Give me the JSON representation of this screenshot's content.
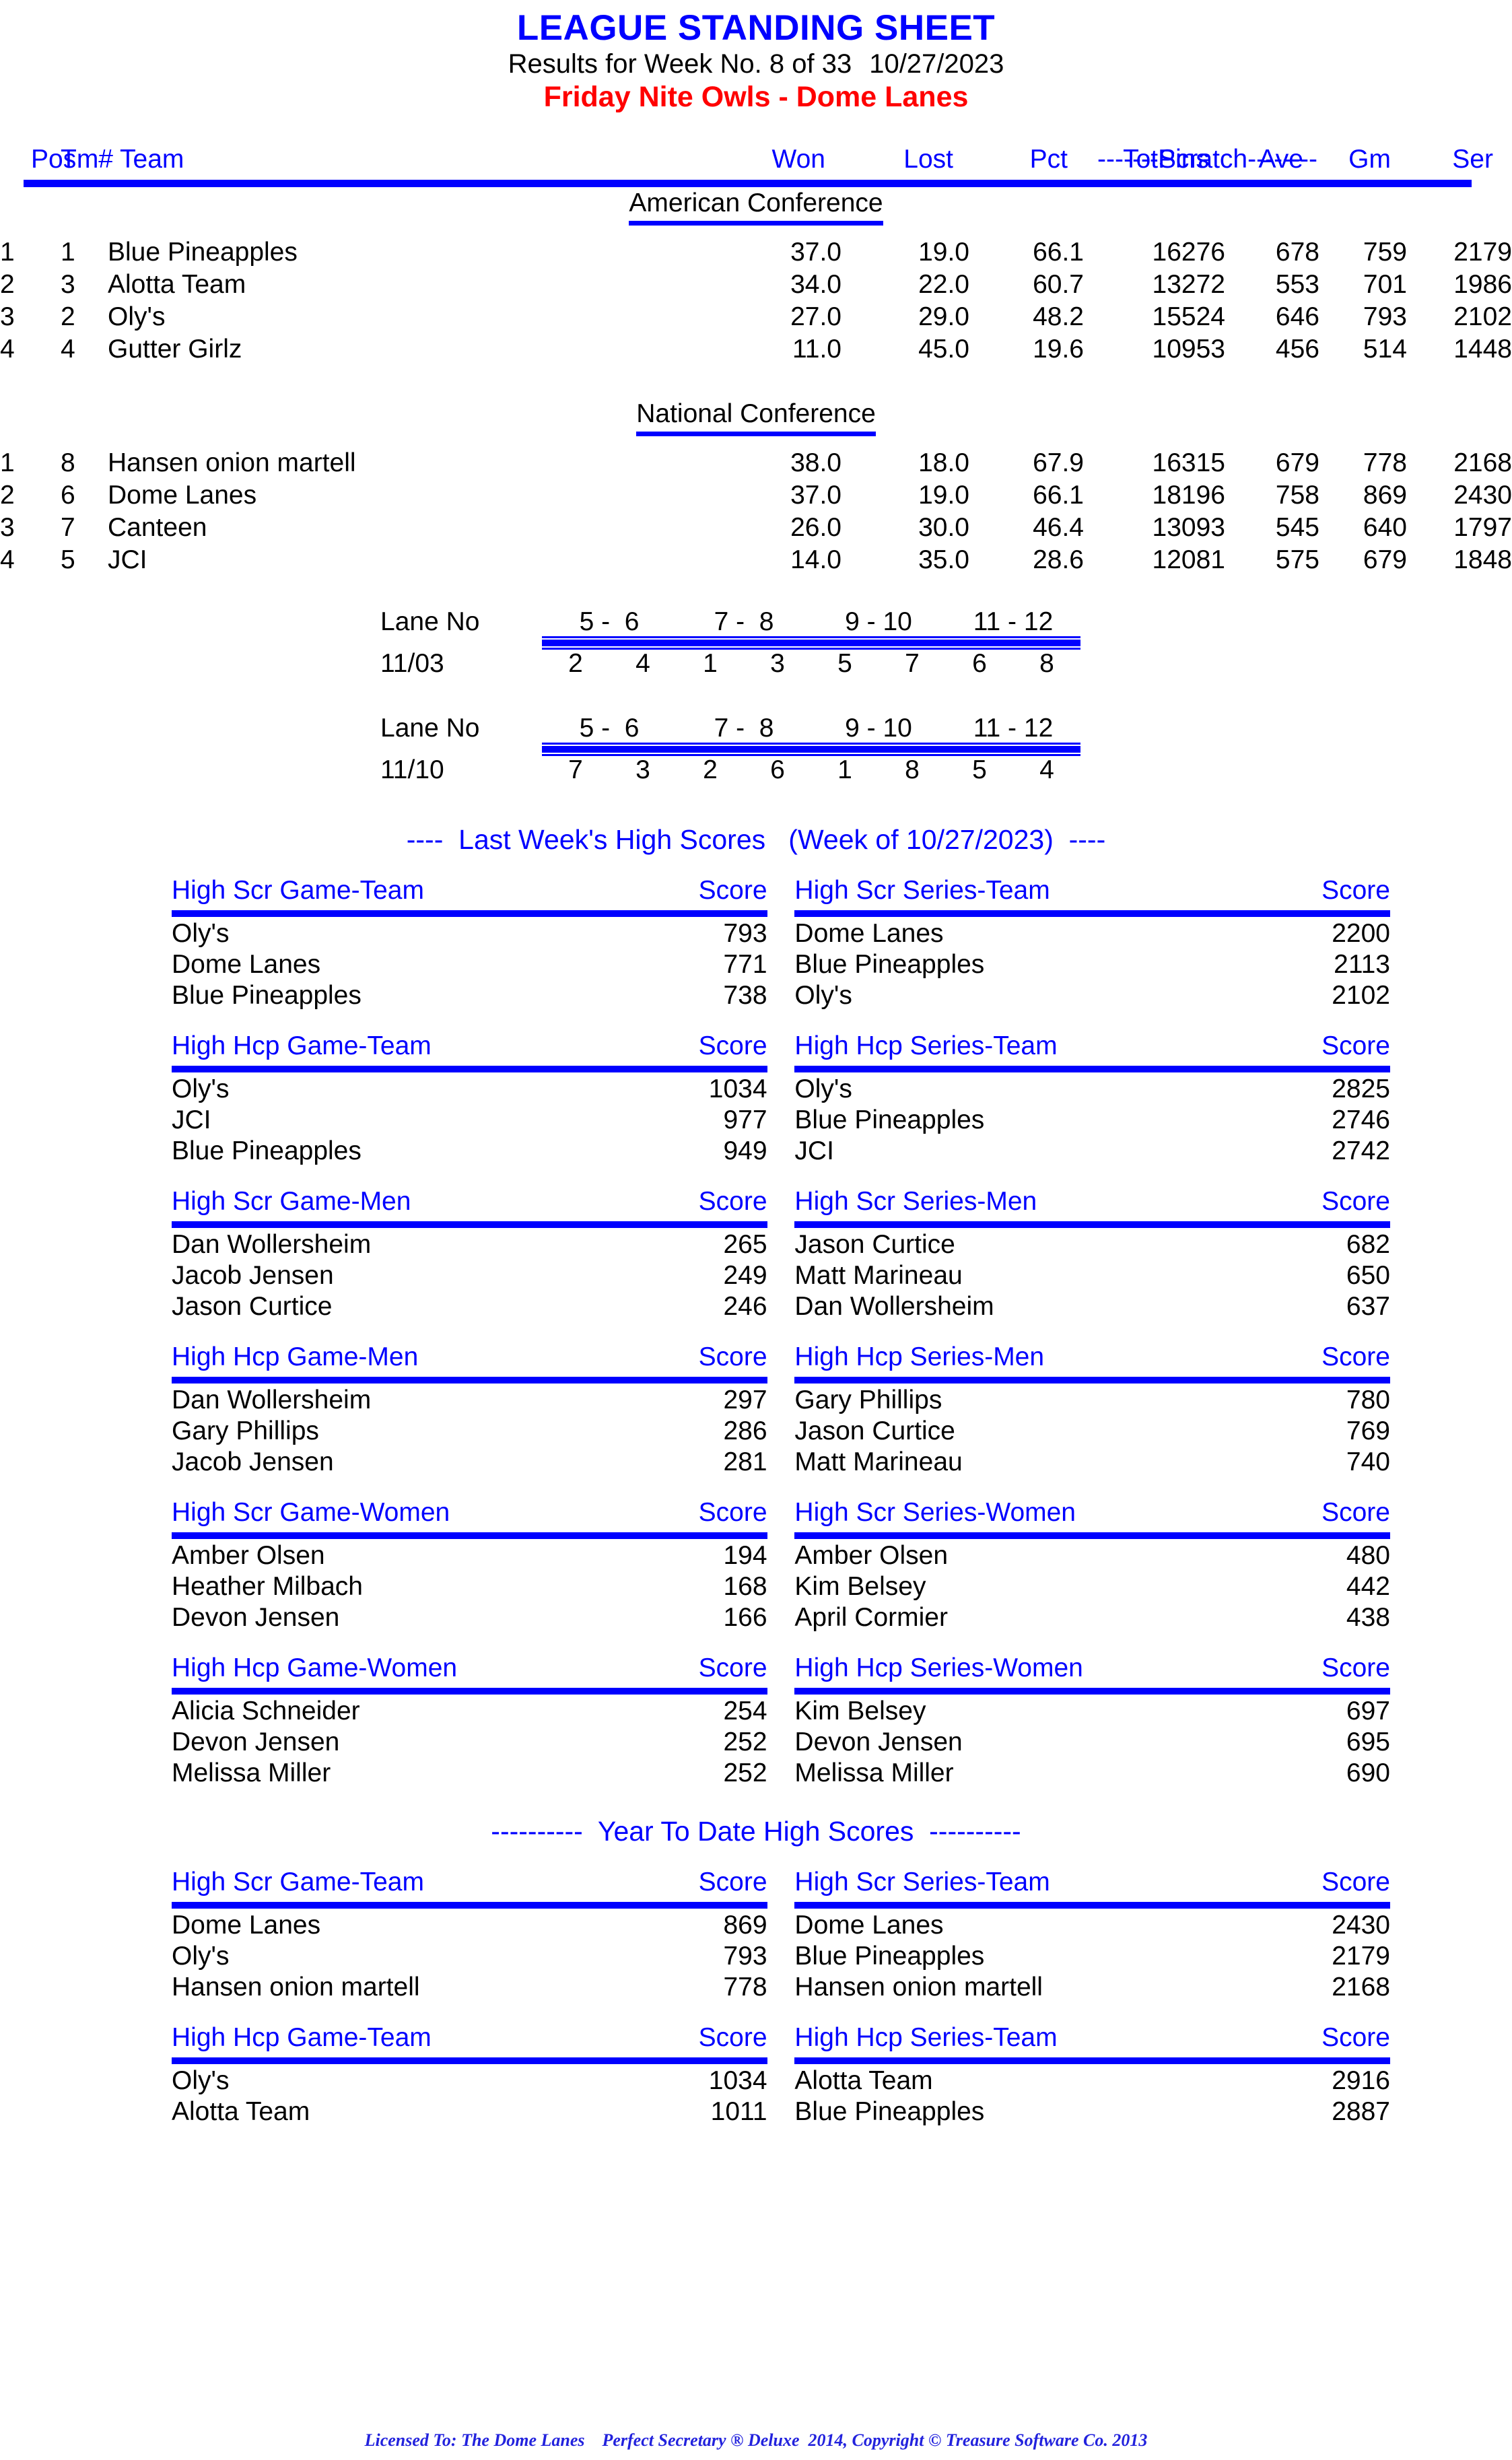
{
  "header": {
    "main_title": "LEAGUE STANDING SHEET",
    "results_line_a": "Results for Week No. 8 of 33",
    "results_line_b": "10/27/2023",
    "league_title": "Friday Nite Owls - Dome Lanes"
  },
  "standings": {
    "scratch_label": "-------Scratch--------",
    "columns": {
      "pos": "Pos",
      "tm": "Tm#",
      "team": "Team",
      "won": "Won",
      "lost": "Lost",
      "pct": "Pct",
      "totpins": "TotPins",
      "ave": "Ave",
      "gm": "Gm",
      "ser": "Ser"
    },
    "conferences": [
      {
        "name": "American Conference",
        "rows": [
          {
            "pos": "1",
            "tm": "1",
            "team": "Blue Pineapples",
            "won": "37.0",
            "lost": "19.0",
            "pct": "66.1",
            "totpins": "16276",
            "ave": "678",
            "gm": "759",
            "ser": "2179"
          },
          {
            "pos": "2",
            "tm": "3",
            "team": "Alotta Team",
            "won": "34.0",
            "lost": "22.0",
            "pct": "60.7",
            "totpins": "13272",
            "ave": "553",
            "gm": "701",
            "ser": "1986"
          },
          {
            "pos": "3",
            "tm": "2",
            "team": "Oly's",
            "won": "27.0",
            "lost": "29.0",
            "pct": "48.2",
            "totpins": "15524",
            "ave": "646",
            "gm": "793",
            "ser": "2102"
          },
          {
            "pos": "4",
            "tm": "4",
            "team": "Gutter Girlz",
            "won": "11.0",
            "lost": "45.0",
            "pct": "19.6",
            "totpins": "10953",
            "ave": "456",
            "gm": "514",
            "ser": "1448"
          }
        ]
      },
      {
        "name": "National Conference",
        "rows": [
          {
            "pos": "1",
            "tm": "8",
            "team": "Hansen onion martell",
            "won": "38.0",
            "lost": "18.0",
            "pct": "67.9",
            "totpins": "16315",
            "ave": "679",
            "gm": "778",
            "ser": "2168"
          },
          {
            "pos": "2",
            "tm": "6",
            "team": "Dome Lanes",
            "won": "37.0",
            "lost": "19.0",
            "pct": "66.1",
            "totpins": "18196",
            "ave": "758",
            "gm": "869",
            "ser": "2430"
          },
          {
            "pos": "3",
            "tm": "7",
            "team": "Canteen",
            "won": "26.0",
            "lost": "30.0",
            "pct": "46.4",
            "totpins": "13093",
            "ave": "545",
            "gm": "640",
            "ser": "1797"
          },
          {
            "pos": "4",
            "tm": "5",
            "team": "JCI",
            "won": "14.0",
            "lost": "35.0",
            "pct": "28.6",
            "totpins": "12081",
            "ave": "575",
            "gm": "679",
            "ser": "1848"
          }
        ]
      }
    ]
  },
  "lane_schedule": {
    "label": "Lane No",
    "pairs": [
      "5 -  6",
      "7 -  8",
      "9 - 10",
      "11 - 12"
    ],
    "weeks": [
      {
        "date": "11/03",
        "teams": [
          "2",
          "4",
          "1",
          "3",
          "5",
          "7",
          "6",
          "8"
        ]
      },
      {
        "date": "11/10",
        "teams": [
          "7",
          "3",
          "2",
          "6",
          "1",
          "8",
          "5",
          "4"
        ]
      }
    ]
  },
  "last_week": {
    "banner": "----  Last Week's High Scores   (Week of 10/27/2023)  ----",
    "score_label": "Score",
    "groups": [
      {
        "left": {
          "title": "High Scr Game-Team",
          "rows": [
            {
              "name": "Oly's",
              "score": "793"
            },
            {
              "name": "Dome Lanes",
              "score": "771"
            },
            {
              "name": "Blue Pineapples",
              "score": "738"
            }
          ]
        },
        "right": {
          "title": "High Scr Series-Team",
          "rows": [
            {
              "name": "Dome Lanes",
              "score": "2200"
            },
            {
              "name": "Blue Pineapples",
              "score": "2113"
            },
            {
              "name": "Oly's",
              "score": "2102"
            }
          ]
        }
      },
      {
        "left": {
          "title": "High Hcp Game-Team",
          "rows": [
            {
              "name": "Oly's",
              "score": "1034"
            },
            {
              "name": "JCI",
              "score": "977"
            },
            {
              "name": "Blue Pineapples",
              "score": "949"
            }
          ]
        },
        "right": {
          "title": "High Hcp Series-Team",
          "rows": [
            {
              "name": "Oly's",
              "score": "2825"
            },
            {
              "name": "Blue Pineapples",
              "score": "2746"
            },
            {
              "name": "JCI",
              "score": "2742"
            }
          ]
        }
      },
      {
        "left": {
          "title": "High Scr Game-Men",
          "rows": [
            {
              "name": "Dan Wollersheim",
              "score": "265"
            },
            {
              "name": "Jacob Jensen",
              "score": "249"
            },
            {
              "name": "Jason Curtice",
              "score": "246"
            }
          ]
        },
        "right": {
          "title": "High Scr Series-Men",
          "rows": [
            {
              "name": "Jason Curtice",
              "score": "682"
            },
            {
              "name": "Matt Marineau",
              "score": "650"
            },
            {
              "name": "Dan Wollersheim",
              "score": "637"
            }
          ]
        }
      },
      {
        "left": {
          "title": "High Hcp Game-Men",
          "rows": [
            {
              "name": "Dan Wollersheim",
              "score": "297"
            },
            {
              "name": "Gary Phillips",
              "score": "286"
            },
            {
              "name": "Jacob Jensen",
              "score": "281"
            }
          ]
        },
        "right": {
          "title": "High Hcp Series-Men",
          "rows": [
            {
              "name": "Gary Phillips",
              "score": "780"
            },
            {
              "name": "Jason Curtice",
              "score": "769"
            },
            {
              "name": "Matt Marineau",
              "score": "740"
            }
          ]
        }
      },
      {
        "left": {
          "title": "High Scr Game-Women",
          "rows": [
            {
              "name": "Amber Olsen",
              "score": "194"
            },
            {
              "name": "Heather Milbach",
              "score": "168"
            },
            {
              "name": "Devon Jensen",
              "score": "166"
            }
          ]
        },
        "right": {
          "title": "High Scr Series-Women",
          "rows": [
            {
              "name": "Amber Olsen",
              "score": "480"
            },
            {
              "name": "Kim Belsey",
              "score": "442"
            },
            {
              "name": "April Cormier",
              "score": "438"
            }
          ]
        }
      },
      {
        "left": {
          "title": "High Hcp Game-Women",
          "rows": [
            {
              "name": "Alicia Schneider",
              "score": "254"
            },
            {
              "name": "Devon Jensen",
              "score": "252"
            },
            {
              "name": "Melissa Miller",
              "score": "252"
            }
          ]
        },
        "right": {
          "title": "High Hcp Series-Women",
          "rows": [
            {
              "name": "Kim Belsey",
              "score": "697"
            },
            {
              "name": "Devon Jensen",
              "score": "695"
            },
            {
              "name": "Melissa Miller",
              "score": "690"
            }
          ]
        }
      }
    ]
  },
  "year_to_date": {
    "banner": "----------  Year To Date High Scores  ----------",
    "score_label": "Score",
    "groups": [
      {
        "left": {
          "title": "High Scr Game-Team",
          "rows": [
            {
              "name": "Dome Lanes",
              "score": "869"
            },
            {
              "name": "Oly's",
              "score": "793"
            },
            {
              "name": "Hansen onion martell",
              "score": "778"
            }
          ]
        },
        "right": {
          "title": "High Scr Series-Team",
          "rows": [
            {
              "name": "Dome Lanes",
              "score": "2430"
            },
            {
              "name": "Blue Pineapples",
              "score": "2179"
            },
            {
              "name": "Hansen onion martell",
              "score": "2168"
            }
          ]
        }
      },
      {
        "left": {
          "title": "High Hcp Game-Team",
          "rows": [
            {
              "name": "Oly's",
              "score": "1034"
            },
            {
              "name": "Alotta Team",
              "score": "1011"
            }
          ]
        },
        "right": {
          "title": "High Hcp Series-Team",
          "rows": [
            {
              "name": "Alotta Team",
              "score": "2916"
            },
            {
              "name": "Blue Pineapples",
              "score": "2887"
            }
          ]
        }
      }
    ]
  },
  "footer": {
    "text": "Licensed To: The Dome Lanes    Perfect Secretary ® Deluxe  2014, Copyright © Treasure Software Co. 2013"
  },
  "colors": {
    "accent_blue": "#0000ff",
    "league_red": "#ff0000",
    "text_black": "#000000",
    "footer_blue": "#2222dd"
  }
}
